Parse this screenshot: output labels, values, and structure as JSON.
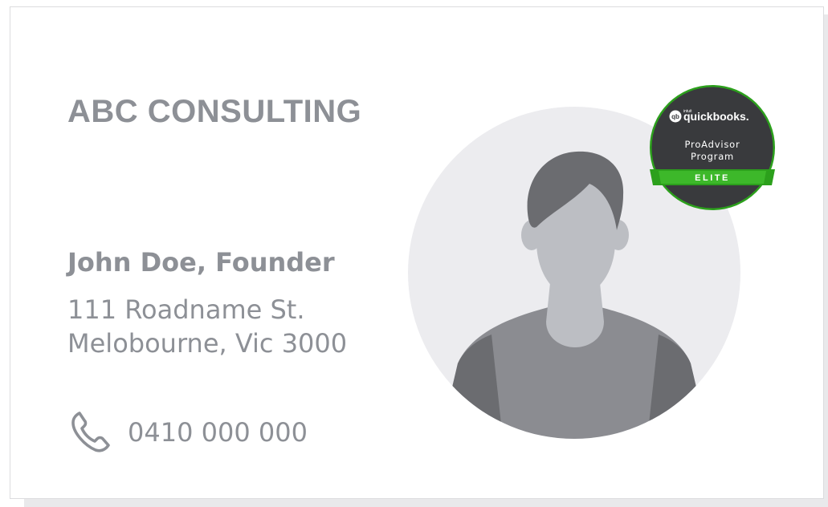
{
  "card": {
    "company": "ABC CONSULTING",
    "person": "John Doe, Founder",
    "address_line1": "111 Roadname St.",
    "address_line2": "Melobourne, Vic 3000",
    "phone": "0410 000 000"
  },
  "badge": {
    "brand_small": "intuit",
    "brand_logo_mark": "qb",
    "brand_name": "quickbooks.",
    "program_line1": "ProAdvisor",
    "program_line2": "Program",
    "level": "ELITE"
  },
  "icons": {
    "phone": "phone-icon",
    "avatar": "person-avatar-icon"
  },
  "colors": {
    "text": "#8d9096",
    "badge_dark": "#393a3d",
    "badge_green": "#2ca01c",
    "avatar_bg": "#ececef"
  }
}
